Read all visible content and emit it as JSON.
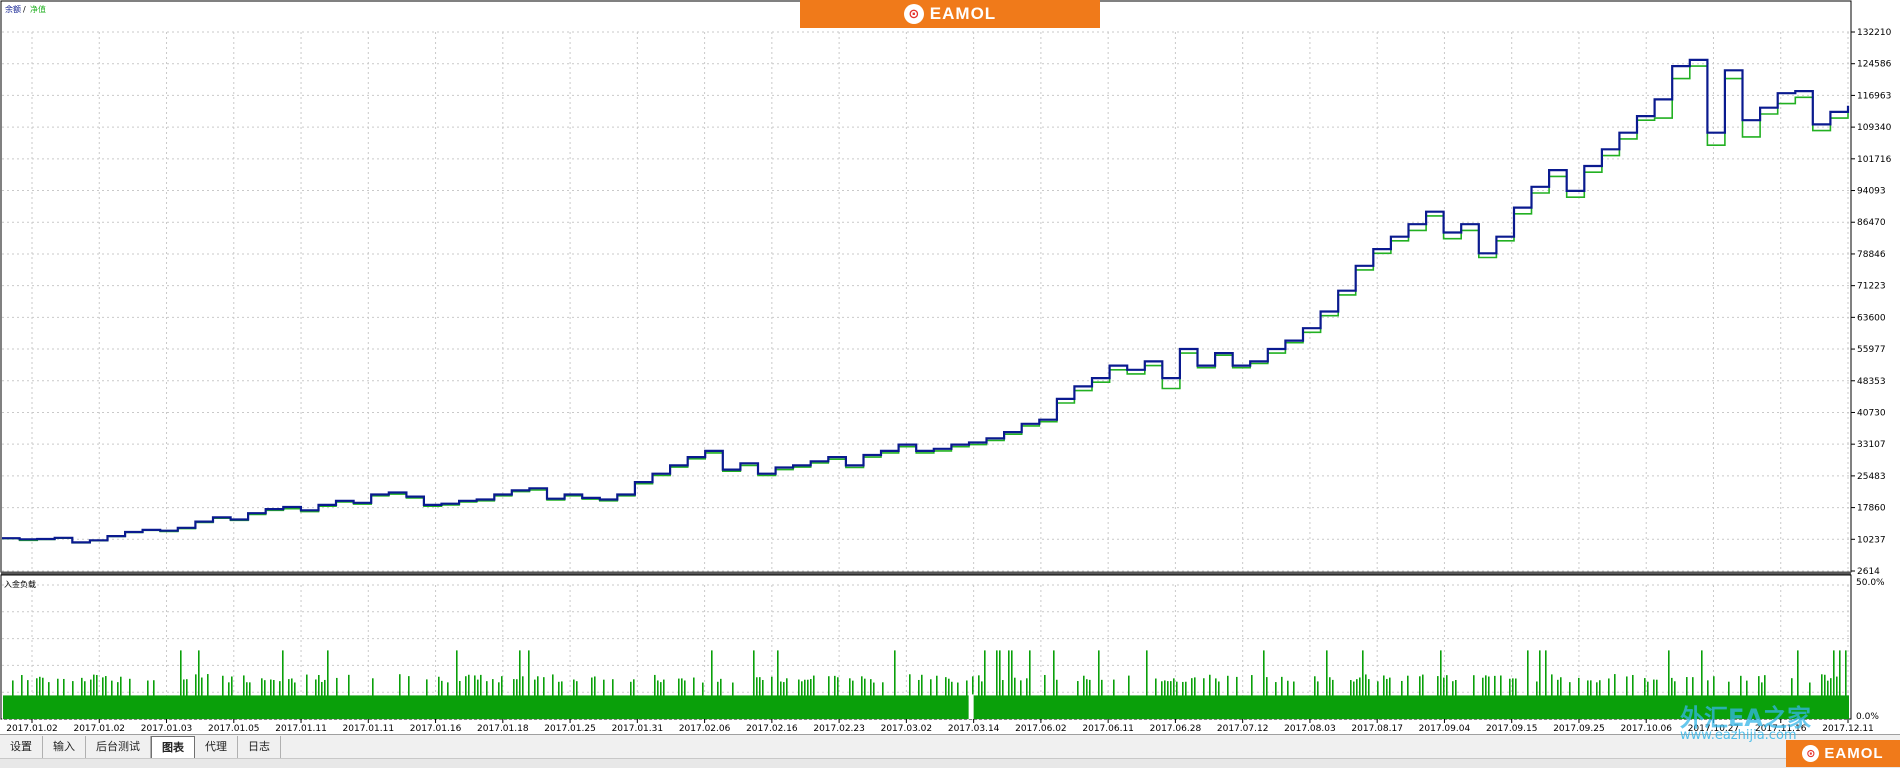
{
  "brand": {
    "name": "EAMOL",
    "color": "#f07a1a"
  },
  "watermark": {
    "text": "外汇EA之家",
    "url": "www.eazhijia.com",
    "color": "#35b6e8"
  },
  "tabs": [
    "设置",
    "输入",
    "后台测试",
    "图表",
    "代理",
    "日志"
  ],
  "active_tab": "图表",
  "chart_data": [
    {
      "type": "line",
      "legend_labels": [
        "余额",
        "净值"
      ],
      "y_ticks": [
        132210,
        124586,
        116963,
        109340,
        101716,
        94093,
        86470,
        78846,
        71223,
        63600,
        55977,
        48353,
        40730,
        33107,
        25483,
        17860,
        10237,
        2614
      ],
      "ylim": [
        2614,
        137000
      ],
      "x_ticks": [
        "2017.01.02",
        "2017.01.02",
        "2017.01.03",
        "2017.01.05",
        "2017.01.11",
        "2017.01.11",
        "2017.01.16",
        "2017.01.18",
        "2017.01.25",
        "2017.01.31",
        "2017.02.06",
        "2017.02.16",
        "2017.02.23",
        "2017.03.02",
        "2017.03.14",
        "2017.06.02",
        "2017.06.11",
        "2017.06.28",
        "2017.07.12",
        "2017.08.03",
        "2017.08.17",
        "2017.09.04",
        "2017.09.15",
        "2017.09.25",
        "2017.10.06",
        "2017.10.27",
        "2017.11.16",
        "2017.12.11"
      ],
      "series": [
        {
          "name": "余额",
          "color": "#0a1a8f",
          "values": [
            10500,
            10237,
            10300,
            10600,
            9500,
            10000,
            11000,
            12000,
            12500,
            12300,
            13000,
            14500,
            15500,
            15000,
            16500,
            17500,
            18000,
            17200,
            18500,
            19500,
            19000,
            21000,
            21500,
            20500,
            18500,
            18800,
            19500,
            19800,
            21000,
            22000,
            22500,
            20000,
            21000,
            20200,
            19800,
            21000,
            24000,
            26000,
            28000,
            30000,
            31500,
            27000,
            28500,
            26000,
            27500,
            28000,
            29000,
            30000,
            28000,
            30500,
            31500,
            33000,
            31500,
            32000,
            33000,
            33500,
            34500,
            36000,
            38000,
            39000,
            44000,
            47000,
            49000,
            52000,
            51000,
            53000,
            49000,
            56000,
            52000,
            55000,
            52000,
            53000,
            56000,
            58000,
            61000,
            65000,
            70000,
            76000,
            80000,
            83000,
            86000,
            89000,
            84000,
            86000,
            79000,
            83000,
            90000,
            95000,
            99000,
            94000,
            100000,
            104000,
            108000,
            112000,
            116000,
            124000,
            125500,
            108000,
            123000,
            111000,
            114000,
            117500,
            118000,
            110000,
            113000,
            114500
          ]
        },
        {
          "name": "净值",
          "color": "#22b022",
          "values": [
            10400,
            10000,
            10200,
            10500,
            9400,
            9900,
            10900,
            11900,
            12400,
            12100,
            12800,
            14300,
            15300,
            14800,
            16200,
            17200,
            17600,
            16900,
            18200,
            19200,
            18700,
            20700,
            21100,
            20200,
            18200,
            18500,
            19200,
            19500,
            20700,
            21700,
            22100,
            19700,
            20700,
            19900,
            19500,
            20700,
            23600,
            25600,
            27600,
            29600,
            31000,
            26600,
            28000,
            25600,
            27000,
            27600,
            28600,
            29500,
            27500,
            30000,
            31000,
            32500,
            31000,
            31500,
            32500,
            33000,
            34000,
            35500,
            37500,
            38500,
            43000,
            46000,
            48000,
            51000,
            50000,
            52000,
            46500,
            55000,
            51500,
            54500,
            51500,
            52500,
            55000,
            57500,
            60000,
            64000,
            69000,
            75000,
            79000,
            82000,
            84500,
            88000,
            82500,
            84500,
            78000,
            82000,
            88500,
            93500,
            97500,
            92500,
            98500,
            102500,
            106500,
            111000,
            111500,
            121000,
            124000,
            105000,
            121000,
            107000,
            112500,
            115000,
            116500,
            108500,
            111500,
            113000
          ]
        }
      ]
    },
    {
      "type": "bar",
      "label": "入金负载",
      "y_ticks": [
        "50.0%",
        "0.0%"
      ],
      "ylim": [
        0,
        50
      ],
      "typical_value": 16,
      "color": "#0aa00a"
    }
  ]
}
